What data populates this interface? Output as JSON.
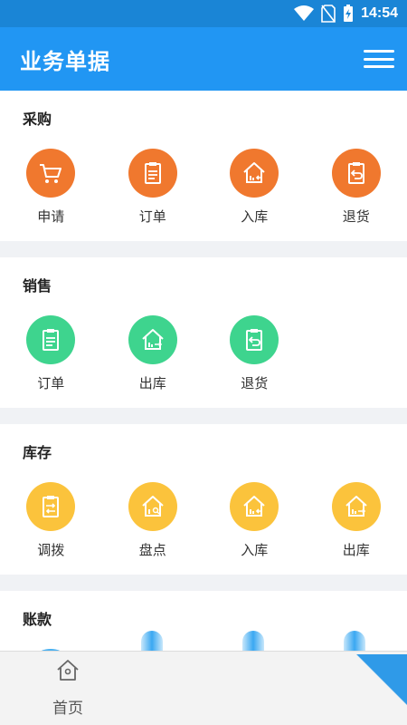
{
  "status": {
    "time": "14:54"
  },
  "appbar": {
    "title": "业务单据"
  },
  "sections": [
    {
      "title": "采购",
      "items": [
        {
          "label": "申请",
          "icon": "cart-icon",
          "color": "#f0782e"
        },
        {
          "label": "订单",
          "icon": "clipboard-icon",
          "color": "#f0782e"
        },
        {
          "label": "入库",
          "icon": "warehouse-in-icon",
          "color": "#f0782e"
        },
        {
          "label": "退货",
          "icon": "return-icon",
          "color": "#f0782e"
        }
      ]
    },
    {
      "title": "销售",
      "items": [
        {
          "label": "订单",
          "icon": "clipboard-icon",
          "color": "#3ed48e"
        },
        {
          "label": "出库",
          "icon": "warehouse-out-icon",
          "color": "#3ed48e"
        },
        {
          "label": "退货",
          "icon": "return-icon",
          "color": "#3ed48e"
        }
      ]
    },
    {
      "title": "库存",
      "items": [
        {
          "label": "调拨",
          "icon": "transfer-icon",
          "color": "#fbc33c"
        },
        {
          "label": "盘点",
          "icon": "inventory-check-icon",
          "color": "#fbc33c"
        },
        {
          "label": "入库",
          "icon": "warehouse-in-icon",
          "color": "#fbc33c"
        },
        {
          "label": "出库",
          "icon": "warehouse-out-icon",
          "color": "#fbc33c"
        }
      ]
    },
    {
      "title": "账款",
      "items": [
        {
          "label": "",
          "icon": "document-icon",
          "color": "#4ab0f0"
        }
      ]
    }
  ],
  "bottomnav": {
    "home_label": "首页",
    "home_icon": "home-icon"
  }
}
